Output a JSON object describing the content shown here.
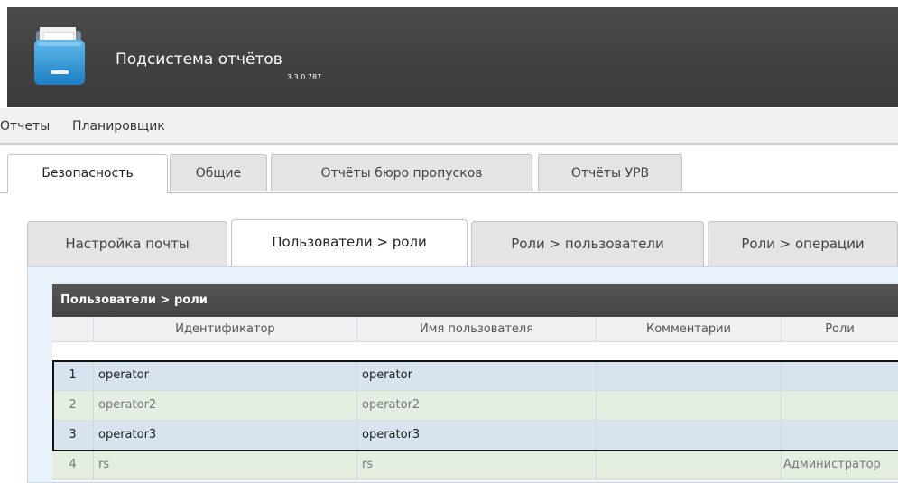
{
  "app": {
    "title": "Подсистема отчётов",
    "version": "3.3.0.787"
  },
  "menu": [
    {
      "label": "Отчеты"
    },
    {
      "label": "Планировщик"
    }
  ],
  "top_tabs": [
    {
      "label": "Безопасность",
      "active": true
    },
    {
      "label": "Общие",
      "active": false
    },
    {
      "label": "Отчёты бюро пропусков",
      "active": false
    },
    {
      "label": "Отчёты УРВ",
      "active": false
    }
  ],
  "sub_tabs": [
    {
      "label": "Настройка почты",
      "active": false
    },
    {
      "label": "Пользователи > роли",
      "active": true
    },
    {
      "label": "Роли > пользователи",
      "active": false
    },
    {
      "label": "Роли > операции",
      "active": false
    }
  ],
  "grid": {
    "caption": "Пользователи > роли",
    "columns": [
      "Идентификатор",
      "Имя пользователя",
      "Комментарии",
      "Роли"
    ],
    "rows": [
      {
        "num": "1",
        "id": "operator",
        "name": "operator",
        "comment": "",
        "roles": "",
        "selected": true
      },
      {
        "num": "2",
        "id": "operator2",
        "name": "operator2",
        "comment": "",
        "roles": "",
        "selected": false
      },
      {
        "num": "3",
        "id": "operator3",
        "name": "operator3",
        "comment": "",
        "roles": "",
        "selected": true
      },
      {
        "num": "4",
        "id": "rs",
        "name": "rs",
        "comment": "",
        "roles": "Администратор",
        "selected": false
      }
    ]
  },
  "colors": {
    "header_bg": "#3f3f3f",
    "selected_row": "#d7e3ee",
    "normal_row": "#e5efe1",
    "grid_caption_bg": "#4a4a4a"
  }
}
